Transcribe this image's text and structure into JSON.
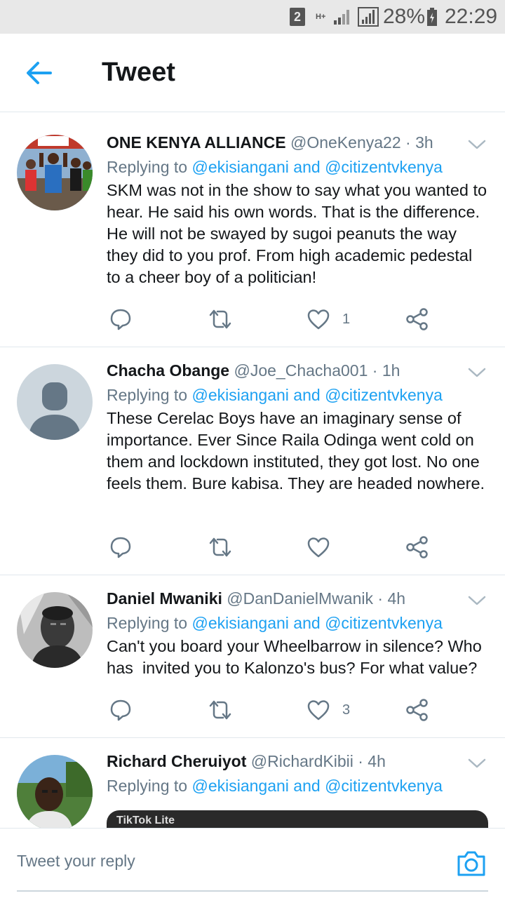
{
  "status_bar": {
    "sim": "2",
    "network": "H+",
    "battery_pct": "28%",
    "time": "22:29"
  },
  "header": {
    "back_icon": "arrow-left-icon",
    "title": "Tweet"
  },
  "reply_prefix": "Replying to ",
  "reply_and": " and ",
  "tweets": [
    {
      "name": "ONE KENYA ALLIANCE",
      "handle": "@OneKenya22",
      "dot": " · ",
      "time": "3h",
      "reply_to_1": "@ekisiangani",
      "reply_to_2": "@citizentvkenya",
      "text": "SKM was not in the show to say what you wanted to hear. He said his own words. That is the difference. He will not be swayed by sugoi peanuts the way they did to you prof. From high academic pedestal to a cheer boy of a politician!",
      "likes": "1"
    },
    {
      "name": "Chacha Obange",
      "handle": "@Joe_Chacha001",
      "dot": " · ",
      "time": "1h",
      "reply_to_1": "@ekisiangani",
      "reply_to_2": "@citizentvkenya",
      "text": "These Cerelac Boys have an imaginary sense of importance. Ever Since Raila Odinga went cold on them and lockdown instituted, they got lost. No one feels them. Bure kabisa. They are headed nowhere.",
      "likes": ""
    },
    {
      "name": "Daniel Mwaniki",
      "handle": "@DanDanielMwanik",
      "dot": " · ",
      "time": "4h",
      "reply_to_1": "@ekisiangani",
      "reply_to_2": "@citizentvkenya",
      "text": "Can't you board your Wheelbarrow in silence? Who has  invited you to Kalonzo's bus? For what value?",
      "likes": "3"
    },
    {
      "name": "Richard Cheruiyot",
      "handle": "@RichardKibii",
      "dot": " · ",
      "time": "4h",
      "reply_to_1": "@ekisiangani",
      "reply_to_2": "@citizentvkenya",
      "media_label": "TikTok Lite"
    }
  ],
  "reply_bar": {
    "placeholder": "Tweet your reply",
    "camera_icon": "camera-icon"
  },
  "colors": {
    "accent": "#1da1f2",
    "text": "#14171a",
    "muted": "#657786",
    "divider": "#e1e8ed"
  }
}
